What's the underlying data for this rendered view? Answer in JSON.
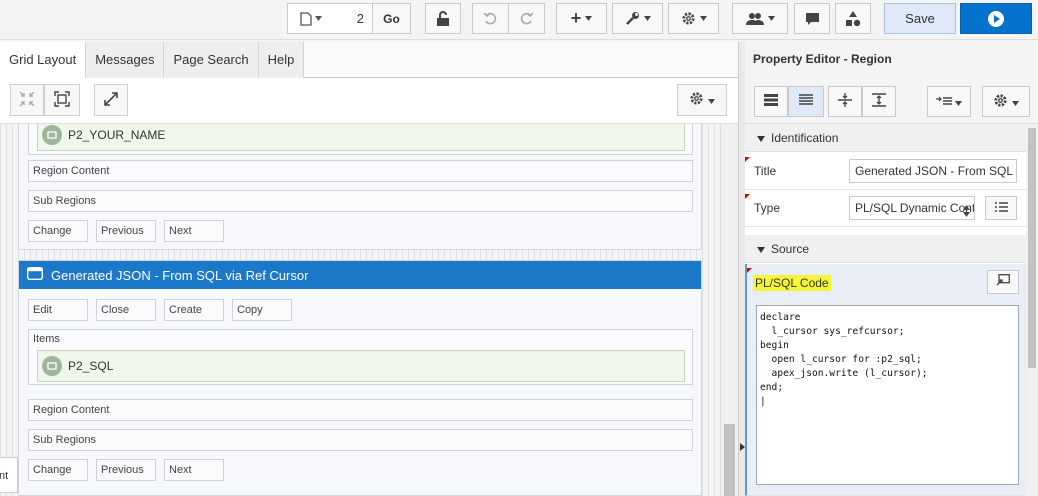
{
  "toolbar": {
    "page_number": "2",
    "go_label": "Go",
    "save_label": "Save"
  },
  "left": {
    "tabs": [
      {
        "label": "Grid Layout"
      },
      {
        "label": "Messages"
      },
      {
        "label": "Page Search"
      },
      {
        "label": "Help"
      }
    ],
    "region_above": {
      "item_name": "P2_YOUR_NAME",
      "region_content": "Region Content",
      "sub_regions": "Sub Regions",
      "buttons": [
        "Change",
        "Previous",
        "Next"
      ]
    },
    "region_selected": {
      "title": "Generated JSON - From SQL via Ref Cursor",
      "top_buttons": [
        "Edit",
        "Close",
        "Create",
        "Copy"
      ],
      "items_label": "Items",
      "item_name": "P2_SQL",
      "region_content": "Region Content",
      "sub_regions": "Sub Regions",
      "buttons": [
        "Change",
        "Previous",
        "Next"
      ]
    },
    "edge_text": "nt"
  },
  "right": {
    "title": "Property Editor - Region",
    "identification": {
      "group_label": "Identification",
      "title_label": "Title",
      "title_value": "Generated JSON - From SQL via Ref Cursor",
      "type_label": "Type",
      "type_value": "PL/SQL Dynamic Content"
    },
    "source": {
      "group_label": "Source",
      "code_label": "PL/SQL Code",
      "code": "declare\n  l_cursor sys_refcursor;\nbegin\n  open l_cursor for :p2_sql;\n  apex_json.write (l_cursor);\nend;\n|"
    }
  },
  "colors": {
    "selected_region_header": "#1c78c8",
    "run_button": "#0572ce",
    "highlight": "#f6f637"
  }
}
